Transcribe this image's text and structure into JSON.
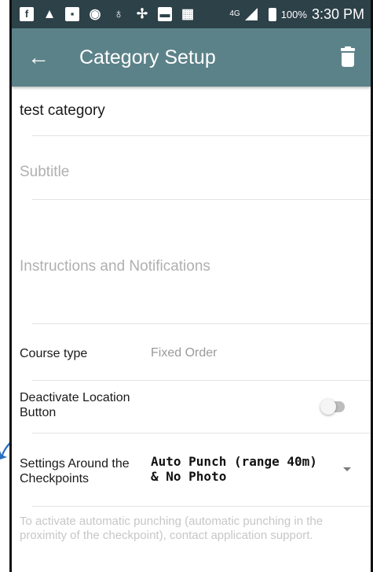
{
  "status_bar": {
    "icons": [
      "facebook-icon",
      "warning-icon",
      "image-icon",
      "wifi-icon",
      "lightbulb-icon",
      "pinwheel-icon",
      "message-icon",
      "vibrate-icon",
      "4g-icon",
      "signal-icon",
      "battery-icon"
    ],
    "network": "4G",
    "battery_percent": "100%",
    "time": "3:30 PM"
  },
  "app_bar": {
    "title": "Category Setup"
  },
  "form": {
    "title_value": "test category",
    "subtitle_placeholder": "Subtitle",
    "instructions_placeholder": "Instructions and Notifications",
    "course_type_label": "Course type",
    "course_type_value": "Fixed Order",
    "deactivate_label": "Deactivate Location Button",
    "deactivate_enabled": false,
    "settings_label": "Settings Around the Checkpoints",
    "settings_value": "Auto Punch (range 40m) & No Photo",
    "note": "To activate automatic punching (automatic punching in the proximity of the checkpoint), contact application support."
  },
  "colors": {
    "status_bar": "#2d4148",
    "app_bar": "#5c8289",
    "pointer_arrow": "#2a6fc0"
  }
}
